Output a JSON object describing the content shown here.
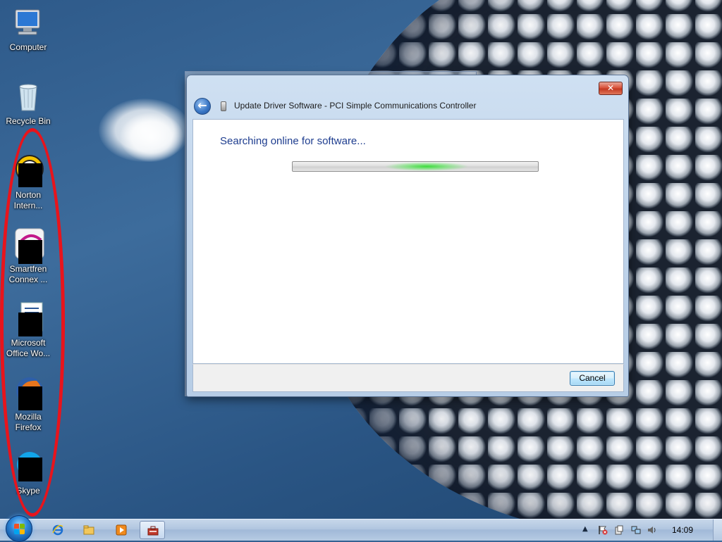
{
  "desktop": {
    "icons": [
      {
        "label": "Computer",
        "icon": "computer-icon"
      },
      {
        "label": "Recycle Bin",
        "icon": "recycle-bin-icon"
      },
      {
        "label": "Norton Intern...",
        "icon": "norton-icon"
      },
      {
        "label": "Smartfren Connex ...",
        "icon": "smartfren-icon"
      },
      {
        "label": "Microsoft Office Wo...",
        "icon": "word-icon"
      },
      {
        "label": "Mozilla Firefox",
        "icon": "firefox-icon"
      },
      {
        "label": "Skype",
        "icon": "skype-icon"
      }
    ]
  },
  "dialog": {
    "title": "Update Driver Software - PCI Simple Communications Controller",
    "close_label": "✕",
    "back_glyph": "←",
    "status": "Searching online for software...",
    "progress": "indeterminate",
    "cancel_label": "Cancel"
  },
  "taskbar": {
    "pinned": [
      "internet-explorer-icon",
      "windows-explorer-icon",
      "media-player-icon",
      "device-manager-icon"
    ],
    "tray_chevron": "▲",
    "clock": "14:09"
  },
  "colors": {
    "annotation_oval": "#e8141c",
    "status_text": "#1e3d8f",
    "progress_glow": "#3cdc3c"
  }
}
